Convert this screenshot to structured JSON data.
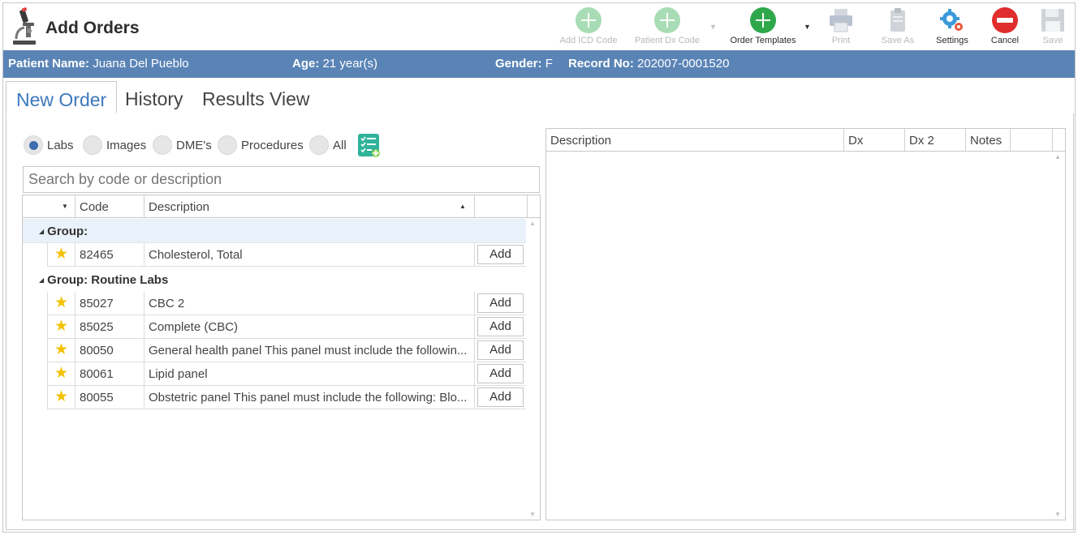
{
  "window": {
    "title": "Add Orders"
  },
  "toolbar": {
    "add_icd_code": "Add ICD Code",
    "patient_dx_code": "Patient Dx Code",
    "order_templates": "Order Templates",
    "print": "Print",
    "save_as": "Save As",
    "settings": "Settings",
    "cancel": "Cancel",
    "save": "Save"
  },
  "patient": {
    "name_label": "Patient Name:",
    "name": "Juana Del Pueblo",
    "age_label": "Age:",
    "age": "21 year(s)",
    "gender_label": "Gender:",
    "gender": "F",
    "record_label": "Record No:",
    "record": "202007-0001520"
  },
  "tabs": [
    "New Order",
    "History",
    "Results View"
  ],
  "active_tab": "New Order",
  "filters": {
    "options": [
      "Labs",
      "Images",
      "DME's",
      "Procedures",
      "All"
    ],
    "selected": "Labs"
  },
  "search": {
    "placeholder": "Search by code or description",
    "value": ""
  },
  "left_grid": {
    "columns": [
      "",
      "Code",
      "Description",
      ""
    ],
    "groups": [
      {
        "label": "Group:",
        "rows": [
          {
            "code": "82465",
            "description": "Cholesterol, Total",
            "action": "Add"
          }
        ]
      },
      {
        "label": "Group: Routine Labs",
        "rows": [
          {
            "code": "85027",
            "description": "CBC 2",
            "action": "Add"
          },
          {
            "code": "85025",
            "description": "Complete (CBC)",
            "action": "Add"
          },
          {
            "code": "80050",
            "description": "General health panel This panel must include the followin...",
            "action": "Add"
          },
          {
            "code": "80061",
            "description": "Lipid panel",
            "action": "Add"
          },
          {
            "code": "80055",
            "description": "Obstetric panel This panel must include the following: Blo...",
            "action": "Add"
          }
        ]
      }
    ]
  },
  "right_grid": {
    "columns": [
      "Description",
      "Dx",
      "Dx 2",
      "Notes",
      ""
    ]
  },
  "colors": {
    "patient_bar": "#5a84b6",
    "tab_active": "#3d78bd",
    "star": "#f2c200",
    "add_green": "#2ea84a",
    "disabled_green": "#a8dcb4",
    "cancel_red": "#e02d2d"
  }
}
